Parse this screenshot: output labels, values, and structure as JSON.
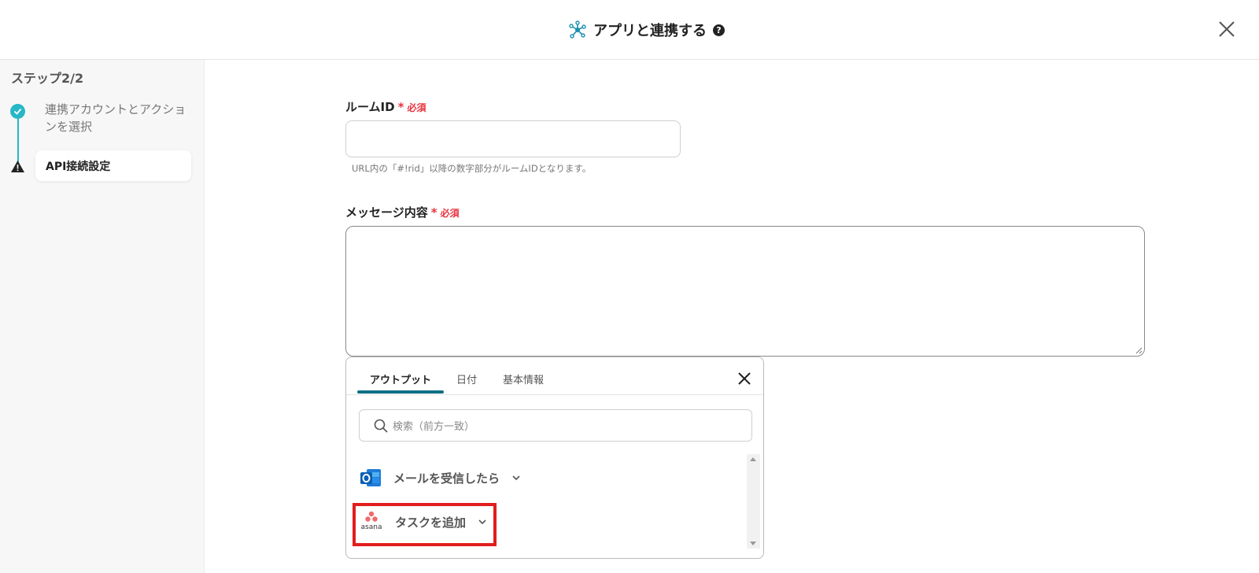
{
  "header": {
    "title": "アプリと連携する",
    "help": "?"
  },
  "sidebar": {
    "step_count": "ステップ2/2",
    "steps": [
      {
        "label": "連携アカウントとアクションを選択",
        "status": "done"
      },
      {
        "label": "API接続設定",
        "status": "warning"
      }
    ]
  },
  "form": {
    "room_id": {
      "label": "ルームID",
      "required": "必須",
      "value": "",
      "hint": "URL内の「#!rid」以降の数字部分がルームIDとなります。"
    },
    "message": {
      "label": "メッセージ内容",
      "required": "必須",
      "value": ""
    }
  },
  "popup": {
    "tabs": [
      "アウトプット",
      "日付",
      "基本情報"
    ],
    "active_tab": "アウトプット",
    "search_placeholder": "検索（前方一致）",
    "items": [
      {
        "label": "メールを受信したら",
        "icon": "outlook-icon"
      },
      {
        "label": "タスクを追加",
        "icon": "asana-icon",
        "highlighted": true
      }
    ],
    "asana_text": "asana"
  },
  "colors": {
    "accent": "#26b8c6",
    "required": "#e8333e",
    "highlight": "#e11d1d",
    "tab_underline": "#0e6f86"
  }
}
